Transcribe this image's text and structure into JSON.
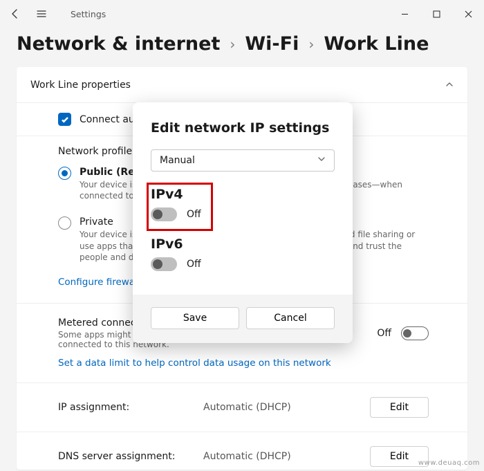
{
  "app": {
    "title": "Settings"
  },
  "breadcrumb": {
    "a": "Network & internet",
    "b": "Wi-Fi",
    "c": "Work Line"
  },
  "card": {
    "title": "Work Line properties",
    "connect_auto": "Connect automatically when in range",
    "network_profile_label": "Network profile type",
    "public": {
      "label": "Public (Recommended)",
      "desc": "Your device is not discoverable on the network. Use this in most cases—when connected to a network at home, work, or in a public place."
    },
    "private": {
      "label": "Private",
      "desc": "Your device is discoverable on the network. Select this if you need file sharing or use apps that communicate over this network. You should know and trust the people and devices on the network."
    },
    "firewall_link": "Configure firewall and security settings",
    "metered": {
      "label": "Metered connection",
      "desc": "Some apps might work differently to reduce data usage when you're connected to this network.",
      "state": "Off"
    },
    "datalimit_link": "Set a data limit to help control data usage on this network",
    "ip": {
      "label": "IP assignment:",
      "value": "Automatic (DHCP)",
      "edit": "Edit"
    },
    "dns": {
      "label": "DNS server assignment:",
      "value": "Automatic (DHCP)",
      "edit": "Edit"
    }
  },
  "dialog": {
    "title": "Edit network IP settings",
    "mode": "Manual",
    "ipv4": {
      "label": "IPv4",
      "state": "Off"
    },
    "ipv6": {
      "label": "IPv6",
      "state": "Off"
    },
    "save": "Save",
    "cancel": "Cancel"
  },
  "watermark": "www.deuaq.com"
}
